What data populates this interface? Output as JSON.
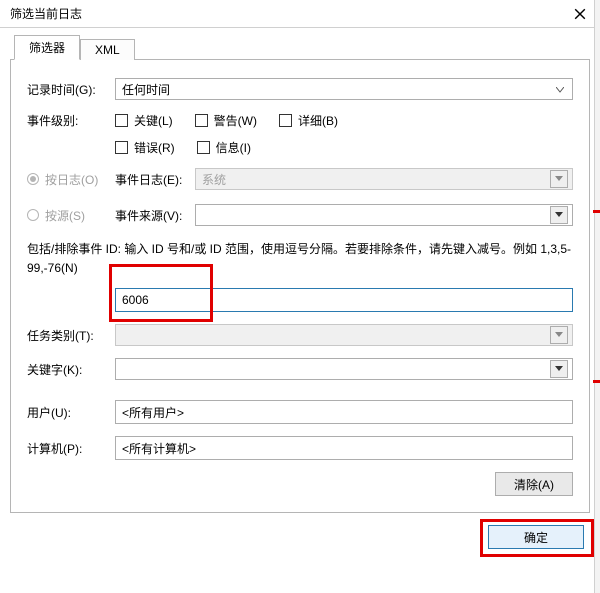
{
  "title": "筛选当前日志",
  "tabs": {
    "filter": "筛选器",
    "xml": "XML"
  },
  "labels": {
    "logged_time": "记录时间(G):",
    "event_level": "事件级别:",
    "by_log": "按日志(O)",
    "by_source": "按源(S)",
    "event_log": "事件日志(E):",
    "event_source": "事件来源(V):",
    "hint": "包括/排除事件 ID: 输入 ID 号和/或 ID 范围，使用逗号分隔。若要排除条件，请先键入减号。例如 1,3,5-99,-76(N)",
    "task_category": "任务类别(T):",
    "keywords": "关键字(K):",
    "user": "用户(U):",
    "computer": "计算机(P):"
  },
  "values": {
    "logged_time": "任何时间",
    "event_log": "系统",
    "event_source": "",
    "event_id": "6006",
    "task_category": "",
    "keywords": "",
    "user": "<所有用户>",
    "computer": "<所有计算机>"
  },
  "checkboxes": {
    "critical": "关键(L)",
    "warning": "警告(W)",
    "verbose": "详细(B)",
    "error": "错误(R)",
    "information": "信息(I)"
  },
  "buttons": {
    "clear": "清除(A)",
    "ok": "确定"
  }
}
